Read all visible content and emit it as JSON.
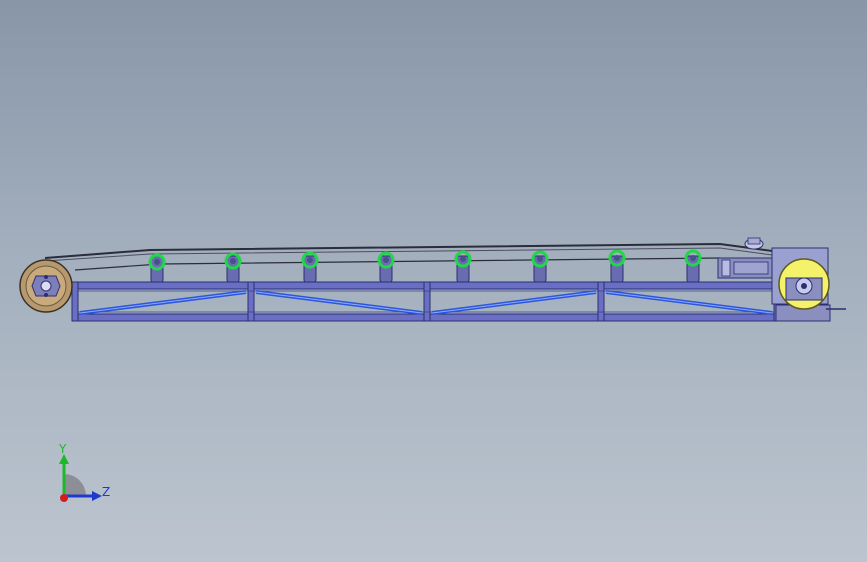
{
  "viewport": {
    "background_top": "#8896a8",
    "background_bottom": "#bcc5cf"
  },
  "model": {
    "frame_color": "#5c61b8",
    "brace_color": "#2c57d9",
    "roller_bracket_color": "#6a6cb0",
    "idler_ring_color": "#22d64a",
    "belt_color": "#2a2d3a",
    "tail_pulley_color": "#b8996e",
    "drive_pulley_color": "#f4f16a",
    "idler_count": 8
  },
  "triad": {
    "y_label": "Y",
    "z_label": "Z",
    "y_color": "#1db82a",
    "z_color": "#1f3ad1",
    "x_color": "#d11f1f"
  }
}
